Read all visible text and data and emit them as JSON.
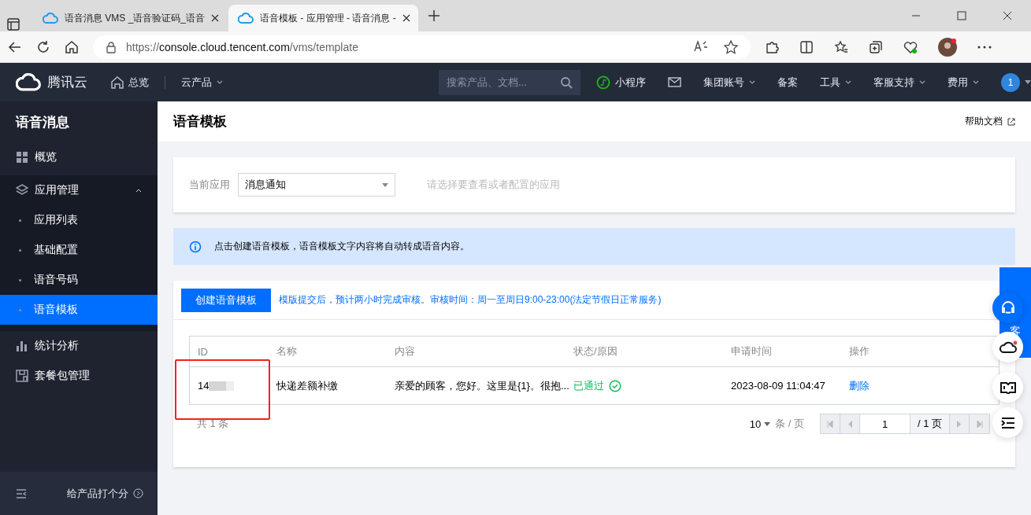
{
  "browser": {
    "tabs": [
      {
        "title": "语音消息 VMS _语音验证码_语音",
        "selected": false
      },
      {
        "title": "语音模板 - 应用管理 - 语音消息 -",
        "selected": true
      }
    ],
    "address": {
      "scheme": "https://",
      "host": "console.cloud.tencent.com",
      "path": "/vms/template"
    }
  },
  "topnav": {
    "brand": "腾讯云",
    "home": "总览",
    "products": "云产品",
    "search": {
      "placeholder": "搜索产品、文档..."
    },
    "items": [
      {
        "kind": "miniapp",
        "label": "小程序",
        "has_menu": false
      },
      {
        "kind": "mail"
      },
      {
        "kind": "text",
        "label": "集团账号",
        "has_menu": true
      },
      {
        "kind": "text",
        "label": "备案",
        "has_menu": false
      },
      {
        "kind": "text",
        "label": "工具",
        "has_menu": true
      },
      {
        "kind": "text",
        "label": "客服支持",
        "has_menu": true
      },
      {
        "kind": "text",
        "label": "费用",
        "has_menu": true
      }
    ],
    "account_badge": "1"
  },
  "sidebar": {
    "title": "语音消息",
    "items": [
      {
        "label": "概览",
        "selected": false
      },
      {
        "label": "应用管理",
        "selected": false,
        "expanded": true,
        "children": [
          {
            "label": "应用列表",
            "selected": false
          },
          {
            "label": "基础配置",
            "selected": false
          },
          {
            "label": "语音号码",
            "selected": false
          },
          {
            "label": "语音模板",
            "selected": true
          }
        ]
      },
      {
        "label": "统计分析",
        "selected": false
      },
      {
        "label": "套餐包管理",
        "selected": false
      }
    ],
    "rate": "给产品打个分"
  },
  "page": {
    "title": "语音模板",
    "help": "帮助文档"
  },
  "app_select": {
    "label": "当前应用",
    "value": "消息通知",
    "hint": "请选择要查看或者配置的应用"
  },
  "notice": "点击创建语音模板，语音模板文字内容将自动转成语音内容。",
  "toolbar": {
    "create": "创建语音模板",
    "note": "模版提交后，预计两小时完成审核。审核时间：周一至周日9:00-23:00(法定节假日正常服务)"
  },
  "table": {
    "columns": [
      "ID",
      "名称",
      "内容",
      "状态/原因",
      "申请时间",
      "操作"
    ],
    "rows": [
      {
        "id": "14",
        "name": "快递差额补缴",
        "content": "亲爱的顾客，您好。这里是{1}。很抱...",
        "status": "已通过",
        "approved": true,
        "time": "2023-08-09 11:04:47",
        "action": "删除"
      }
    ]
  },
  "footer": {
    "total": "共 1 条",
    "page_size": "10",
    "per_page": "条 / 页",
    "page": "1",
    "pages": "/ 1 页"
  },
  "float": {
    "service_label": "客"
  }
}
